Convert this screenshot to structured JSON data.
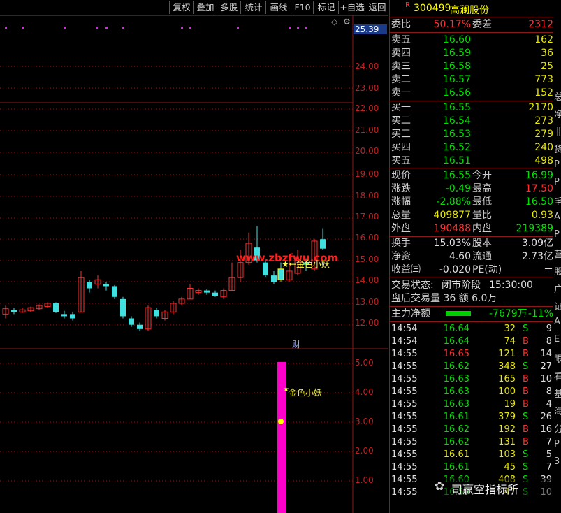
{
  "toolbar": {
    "items": [
      "复权",
      "叠加",
      "多股",
      "统计",
      "画线",
      "F10",
      "标记",
      "+自选",
      "返回"
    ]
  },
  "chart": {
    "price_axis": [
      "25.39",
      "24.00",
      "23.00",
      "22.00",
      "21.00",
      "20.00",
      "19.00",
      "18.00",
      "17.00",
      "16.00",
      "15.00",
      "14.00",
      "13.00",
      "12.00"
    ],
    "indicator_axis": [
      "5.00",
      "4.00",
      "3.00",
      "2.00",
      "1.00"
    ],
    "marker_label": "★←金色小妖",
    "indicator_label": "金色小妖",
    "finance_badge": "财",
    "watermark": "www.zbzfwu.com",
    "colors": {
      "up": "#ff3030",
      "down": "#40e0e0",
      "accent": "#ff00cc",
      "grid": "#8a1a1a"
    }
  },
  "quote": {
    "code": "300499",
    "name": "高澜股份",
    "mark": "R",
    "ratio_label": "委比",
    "ratio_value": "50.17%",
    "diff_label": "委差",
    "diff_value": "2312",
    "asks": [
      {
        "label": "卖五",
        "price": "16.60",
        "vol": "162"
      },
      {
        "label": "卖四",
        "price": "16.59",
        "vol": "36"
      },
      {
        "label": "卖三",
        "price": "16.58",
        "vol": "25"
      },
      {
        "label": "卖二",
        "price": "16.57",
        "vol": "773"
      },
      {
        "label": "卖一",
        "price": "16.56",
        "vol": "152"
      }
    ],
    "bids": [
      {
        "label": "买一",
        "price": "16.55",
        "vol": "2170"
      },
      {
        "label": "买二",
        "price": "16.54",
        "vol": "273"
      },
      {
        "label": "买三",
        "price": "16.53",
        "vol": "279"
      },
      {
        "label": "买四",
        "price": "16.52",
        "vol": "240"
      },
      {
        "label": "买五",
        "price": "16.51",
        "vol": "498"
      }
    ],
    "stats": [
      {
        "l1": "现价",
        "v1": "16.55",
        "l2": "今开",
        "v2": "16.99"
      },
      {
        "l1": "涨跌",
        "v1": "-0.49",
        "l2": "最高",
        "v2": "17.50"
      },
      {
        "l1": "涨幅",
        "v1": "-2.88%",
        "l2": "最低",
        "v2": "16.50"
      },
      {
        "l1": "总量",
        "v1": "409877",
        "l2": "量比",
        "v2": "0.93"
      },
      {
        "l1": "外盘",
        "v1": "190488",
        "l2": "内盘",
        "v2": "219389"
      }
    ],
    "stats2": [
      {
        "l1": "换手",
        "v1": "15.03%",
        "l2": "股本",
        "v2": "3.09亿"
      },
      {
        "l1": "净资",
        "v1": "4.60",
        "l2": "流通",
        "v2": "2.73亿"
      },
      {
        "l1": "收益㈢",
        "v1": "-0.020",
        "l2": "PE(动)",
        "v2": "－"
      }
    ],
    "trade_status_label": "交易状态:",
    "trade_status": "闭市阶段",
    "trade_time": "15:30:00",
    "after_hours": "盘后交易量 36 额 6.0万",
    "main_flow_label": "主力净额",
    "main_flow_value": "-7679万",
    "main_flow_pct": "-11%"
  },
  "ticks": [
    {
      "t": "14:54",
      "p": "16.64",
      "v": "32",
      "d": "S",
      "n": "9"
    },
    {
      "t": "14:54",
      "p": "16.64",
      "v": "74",
      "d": "B",
      "n": "8"
    },
    {
      "t": "14:55",
      "p": "16.65",
      "v": "121",
      "d": "B",
      "n": "14"
    },
    {
      "t": "14:55",
      "p": "16.62",
      "v": "348",
      "d": "S",
      "n": "27"
    },
    {
      "t": "14:55",
      "p": "16.63",
      "v": "165",
      "d": "B",
      "n": "10"
    },
    {
      "t": "14:55",
      "p": "16.63",
      "v": "100",
      "d": "B",
      "n": "8"
    },
    {
      "t": "14:55",
      "p": "16.63",
      "v": "19",
      "d": "B",
      "n": "4"
    },
    {
      "t": "14:55",
      "p": "16.61",
      "v": "379",
      "d": "S",
      "n": "26"
    },
    {
      "t": "14:55",
      "p": "16.62",
      "v": "192",
      "d": "B",
      "n": "16"
    },
    {
      "t": "14:55",
      "p": "16.62",
      "v": "131",
      "d": "B",
      "n": "7"
    },
    {
      "t": "14:55",
      "p": "16.61",
      "v": "103",
      "d": "S",
      "n": "5"
    },
    {
      "t": "14:55",
      "p": "16.61",
      "v": "45",
      "d": "S",
      "n": "7"
    },
    {
      "t": "14:55",
      "p": "16.60",
      "v": "408",
      "d": "S",
      "n": "39"
    },
    {
      "t": "14:55",
      "p": "16.59",
      "v": "47",
      "d": "S",
      "n": "10"
    }
  ],
  "wechat_watermark": "司赢空指标所",
  "edge_chars": [
    "总",
    "净",
    "非",
    "货",
    "P",
    "P",
    "毛",
    "A",
    "P",
    "营",
    "股",
    "广",
    "证",
    "A",
    "E",
    "眼",
    "看",
    "基",
    "海",
    "分",
    "P",
    "3"
  ]
}
